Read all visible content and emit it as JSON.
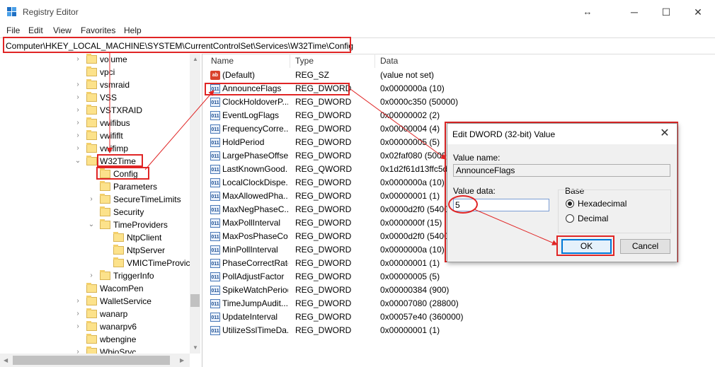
{
  "window": {
    "title": "Registry Editor"
  },
  "menu": [
    "File",
    "Edit",
    "View",
    "Favorites",
    "Help"
  ],
  "address": "Computer\\HKEY_LOCAL_MACHINE\\SYSTEM\\CurrentControlSet\\Services\\W32Time\\Config",
  "tree": [
    {
      "label": "volume",
      "expander": ">"
    },
    {
      "label": "vpci",
      "expander": ""
    },
    {
      "label": "vsmraid",
      "expander": ">"
    },
    {
      "label": "VSS",
      "expander": ">"
    },
    {
      "label": "VSTXRAID",
      "expander": ">"
    },
    {
      "label": "vwifibus",
      "expander": ">"
    },
    {
      "label": "vwififlt",
      "expander": ">"
    },
    {
      "label": "vwifimp",
      "expander": ">"
    },
    {
      "label": "W32Time",
      "expander": "v"
    },
    {
      "label": "Config",
      "expander": ""
    },
    {
      "label": "Parameters",
      "expander": ""
    },
    {
      "label": "SecureTimeLimits",
      "expander": ">"
    },
    {
      "label": "Security",
      "expander": ""
    },
    {
      "label": "TimeProviders",
      "expander": "v"
    },
    {
      "label": "NtpClient",
      "expander": ""
    },
    {
      "label": "NtpServer",
      "expander": ""
    },
    {
      "label": "VMICTimeProvic",
      "expander": ""
    },
    {
      "label": "TriggerInfo",
      "expander": ">"
    },
    {
      "label": "WacomPen",
      "expander": ""
    },
    {
      "label": "WalletService",
      "expander": ">"
    },
    {
      "label": "wanarp",
      "expander": ">"
    },
    {
      "label": "wanarpv6",
      "expander": ">"
    },
    {
      "label": "wbengine",
      "expander": ""
    },
    {
      "label": "WbioSrvc",
      "expander": ">"
    }
  ],
  "list": {
    "headers": {
      "name": "Name",
      "type": "Type",
      "data": "Data"
    },
    "rows": [
      {
        "name": "(Default)",
        "type": "REG_SZ",
        "data": "(value not set)",
        "icon": "ab"
      },
      {
        "name": "AnnounceFlags",
        "type": "REG_DWORD",
        "data": "0x0000000a (10)",
        "icon": "bin"
      },
      {
        "name": "ClockHoldoverP...",
        "type": "REG_DWORD",
        "data": "0x0000c350 (50000)",
        "icon": "bin"
      },
      {
        "name": "EventLogFlags",
        "type": "REG_DWORD",
        "data": "0x00000002 (2)",
        "icon": "bin"
      },
      {
        "name": "FrequencyCorre...",
        "type": "REG_DWORD",
        "data": "0x00000004 (4)",
        "icon": "bin"
      },
      {
        "name": "HoldPeriod",
        "type": "REG_DWORD",
        "data": "0x00000005 (5)",
        "icon": "bin"
      },
      {
        "name": "LargePhaseOffset",
        "type": "REG_DWORD",
        "data": "0x02faf080 (50000",
        "icon": "bin"
      },
      {
        "name": "LastKnownGood...",
        "type": "REG_QWORD",
        "data": "0x1d2f61d13ffc5d",
        "icon": "bin"
      },
      {
        "name": "LocalClockDispe...",
        "type": "REG_DWORD",
        "data": "0x0000000a (10)",
        "icon": "bin"
      },
      {
        "name": "MaxAllowedPha...",
        "type": "REG_DWORD",
        "data": "0x00000001 (1)",
        "icon": "bin"
      },
      {
        "name": "MaxNegPhaseC...",
        "type": "REG_DWORD",
        "data": "0x0000d2f0 (54000",
        "icon": "bin"
      },
      {
        "name": "MaxPollInterval",
        "type": "REG_DWORD",
        "data": "0x0000000f (15)",
        "icon": "bin"
      },
      {
        "name": "MaxPosPhaseCo...",
        "type": "REG_DWORD",
        "data": "0x0000d2f0 (54000",
        "icon": "bin"
      },
      {
        "name": "MinPollInterval",
        "type": "REG_DWORD",
        "data": "0x0000000a (10)",
        "icon": "bin"
      },
      {
        "name": "PhaseCorrectRate",
        "type": "REG_DWORD",
        "data": "0x00000001 (1)",
        "icon": "bin"
      },
      {
        "name": "PollAdjustFactor",
        "type": "REG_DWORD",
        "data": "0x00000005 (5)",
        "icon": "bin"
      },
      {
        "name": "SpikeWatchPeriod",
        "type": "REG_DWORD",
        "data": "0x00000384 (900)",
        "icon": "bin"
      },
      {
        "name": "TimeJumpAudit...",
        "type": "REG_DWORD",
        "data": "0x00007080 (28800)",
        "icon": "bin"
      },
      {
        "name": "UpdateInterval",
        "type": "REG_DWORD",
        "data": "0x00057e40 (360000)",
        "icon": "bin"
      },
      {
        "name": "UtilizeSslTimeDa...",
        "type": "REG_DWORD",
        "data": "0x00000001 (1)",
        "icon": "bin"
      }
    ]
  },
  "dialog": {
    "title": "Edit DWORD (32-bit) Value",
    "value_name_label": "Value name:",
    "value_name": "AnnounceFlags",
    "value_data_label": "Value data:",
    "value_data": "5",
    "base_label": "Base",
    "hex_label": "Hexadecimal",
    "dec_label": "Decimal",
    "ok_label": "OK",
    "cancel_label": "Cancel"
  },
  "icons": {
    "window_controls": [
      "resize-icon",
      "minimize-icon",
      "maximize-icon",
      "close-icon"
    ]
  },
  "colors": {
    "highlight": "#e02525",
    "folder": "#fce28b",
    "accent": "#0078d7"
  }
}
